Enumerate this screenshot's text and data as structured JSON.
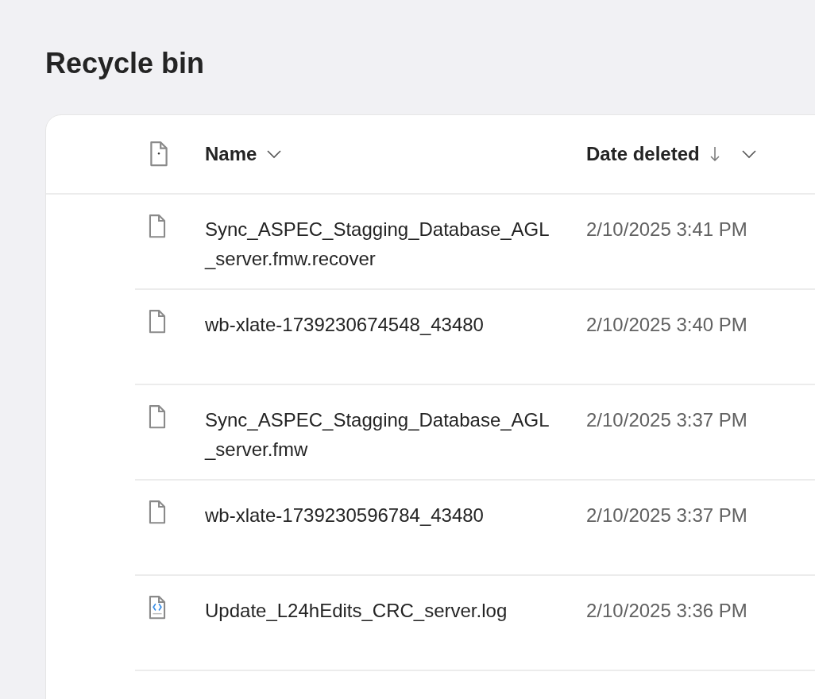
{
  "title": "Recycle bin",
  "columns": [
    {
      "label": "Name",
      "sorted": false
    },
    {
      "label": "Date deleted",
      "sorted": true
    }
  ],
  "rows": [
    {
      "kind": "file",
      "name": "Sync_ASPEC_Stagging_Database_AGL_server.fmw.recover",
      "date": "2/10/2025 3:41 PM"
    },
    {
      "kind": "file",
      "name": "wb-xlate-1739230674548_43480",
      "date": "2/10/2025 3:40 PM"
    },
    {
      "kind": "file",
      "name": "Sync_ASPEC_Stagging_Database_AGL_server.fmw",
      "date": "2/10/2025 3:37 PM"
    },
    {
      "kind": "file",
      "name": "wb-xlate-1739230596784_43480",
      "date": "2/10/2025 3:37 PM"
    },
    {
      "kind": "code",
      "name": "Update_L24hEdits_CRC_server.log",
      "date": "2/10/2025 3:36 PM"
    }
  ]
}
